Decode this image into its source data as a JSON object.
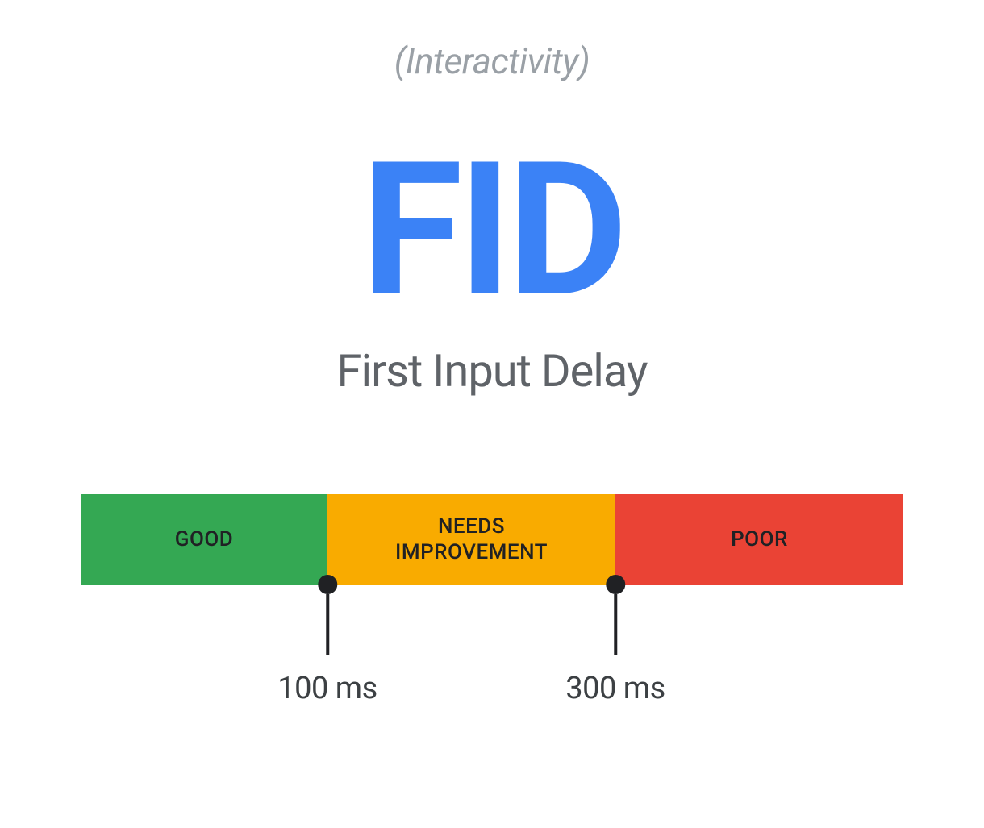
{
  "header": {
    "category": "(Interactivity)",
    "acronym": "FID",
    "full_name": "First Input Delay"
  },
  "scale": {
    "segments": {
      "good": {
        "label": "GOOD",
        "color": "#34a853"
      },
      "needs": {
        "label_line1": "NEEDS",
        "label_line2": "IMPROVEMENT",
        "color": "#f9ab00"
      },
      "poor": {
        "label": "POOR",
        "color": "#ea4335"
      }
    },
    "thresholds": {
      "first": "100 ms",
      "second": "300 ms"
    }
  },
  "colors": {
    "accent_blue": "#3b82f6",
    "text_gray": "#5f6368",
    "text_light_gray": "#9aa0a6",
    "marker_dark": "#202124"
  }
}
